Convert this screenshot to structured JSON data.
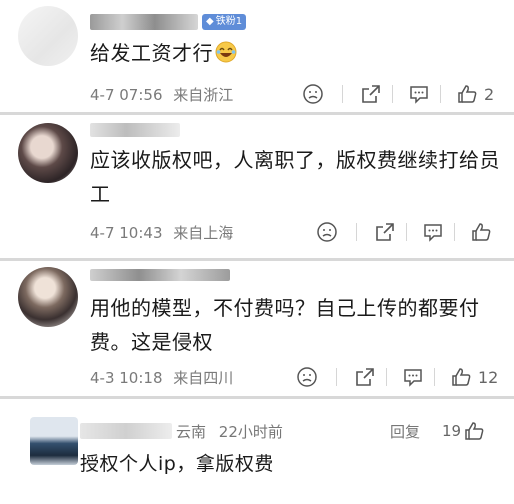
{
  "comments": [
    {
      "badge": "铁粉1",
      "text": "给发工资才行",
      "date": "4-7 07:56",
      "location": "来自浙江",
      "likes": "2"
    },
    {
      "text_line1": "应该收版权吧，人离职了，版权费继续打给员",
      "text_line2": "工",
      "date": "4-7 10:43",
      "location": "来自上海",
      "likes": ""
    },
    {
      "text_line1": "用他的模型，不付费吗？自己上传的都要付",
      "text_line2": "费。这是侵权",
      "date": "4-3 10:18",
      "location": "来自四川",
      "likes": "12"
    },
    {
      "region": "云南",
      "time": "22小时前",
      "reply_label": "回复",
      "likes": "19",
      "text": "授权个人ip，拿版权费"
    }
  ],
  "colors": {
    "badge": "#5f8dd8",
    "meta": "#7a7a7a",
    "icon": "#555555",
    "divider": "#d8d8d8"
  }
}
